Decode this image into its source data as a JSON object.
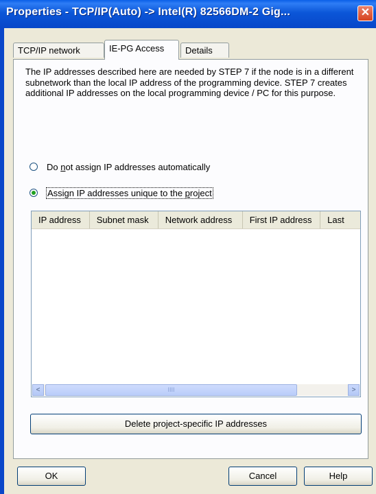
{
  "window": {
    "title": "Properties - TCP/IP(Auto) -> Intel(R) 82566DM-2 Gig...",
    "close_glyph": "✕"
  },
  "tabs": [
    {
      "label": "TCP/IP network",
      "active": false
    },
    {
      "label": "IE-PG Access",
      "active": true
    },
    {
      "label": "Details",
      "active": false
    }
  ],
  "panel": {
    "description": "The IP addresses described here are needed by STEP 7 if the node is in a different subnetwork than the local IP address of the programming device. STEP 7 creates additional IP addresses on the local programming device / PC for this purpose.",
    "radio_options": [
      {
        "label_pre": "Do ",
        "label_accel": "n",
        "label_post": "ot assign IP addresses automatically",
        "checked": false
      },
      {
        "label_pre": "Assign IP addresses unique to the ",
        "label_accel": "p",
        "label_post": "roject",
        "checked": true
      }
    ],
    "table": {
      "columns": [
        "IP address",
        "Subnet mask",
        "Network address",
        "First IP address",
        "Last"
      ],
      "rows": []
    },
    "scrollbar": {
      "left_glyph": "<",
      "right_glyph": ">",
      "thumb_grip": "IIII"
    },
    "delete_button_label": "Delete project-specific IP addresses"
  },
  "footer": {
    "ok_label": "OK",
    "cancel_label": "Cancel",
    "help_label": "Help"
  }
}
